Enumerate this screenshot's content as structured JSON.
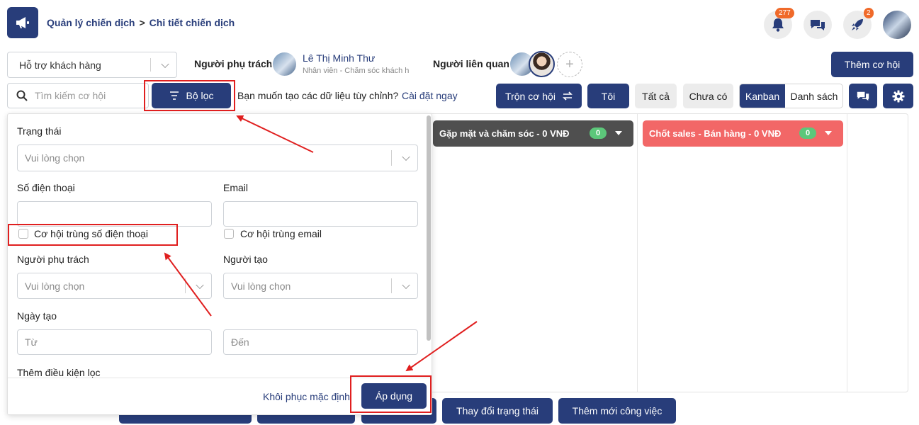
{
  "header": {
    "breadcrumb_parent": "Quản lý chiến dịch",
    "breadcrumb_sep": ">",
    "breadcrumb_current": "Chi tiết chiến dịch",
    "notif_count": "277",
    "rocket_count": "2"
  },
  "toolbar": {
    "campaign_select": "Hỗ trợ khách hàng",
    "owner_label": "Người phụ trách",
    "owner_name": "Lê Thị Minh Thư",
    "owner_role": "Nhân viên - Chăm sóc khách h",
    "related_label": "Người liên quan",
    "add_opportunity": "Thêm cơ hội",
    "search_placeholder": "Tìm kiếm cơ hội",
    "filter_label": "Bộ lọc",
    "custom_prompt": "Bạn muốn tạo các dữ liệu tùy chỉnh?",
    "custom_link": "Cài đặt ngay",
    "merge_label": "Trộn cơ hội",
    "me_label": "Tôi",
    "all_label": "Tất cả",
    "none_label": "Chưa có",
    "kanban_label": "Kanban",
    "list_label": "Danh sách"
  },
  "filter": {
    "status_label": "Trạng thái",
    "status_placeholder": "Vui lòng chọn",
    "phone_label": "Số điện thoại",
    "email_label": "Email",
    "dup_phone_label": "Cơ hội trùng số điện thoại",
    "dup_email_label": "Cơ hội trùng email",
    "owner_label": "Người phụ trách",
    "owner_placeholder": "Vui lòng chọn",
    "creator_label": "Người tạo",
    "creator_placeholder": "Vui lòng chọn",
    "created_label": "Ngày tạo",
    "from_placeholder": "Từ",
    "to_placeholder": "Đến",
    "more_conditions": "Thêm điều kiện lọc",
    "reset_label": "Khôi phục mặc định",
    "apply_label": "Áp dụng"
  },
  "kanban": {
    "columns": [
      {
        "title": "Gặp mặt và chăm sóc - 0 VNĐ",
        "count": "0",
        "color": "#4f4f4f"
      },
      {
        "title": "Chốt sales - Bán hàng - 0 VNĐ",
        "count": "0",
        "color": "#f26767"
      }
    ]
  },
  "bottom_actions": {
    "change_status": "Thay đổi trạng thái",
    "add_task": "Thêm mới công việc"
  },
  "colors": {
    "primary": "#283d7a",
    "annotation_red": "#e01f1f",
    "count_green": "#5cc77a",
    "badge_orange": "#f06a2a"
  }
}
